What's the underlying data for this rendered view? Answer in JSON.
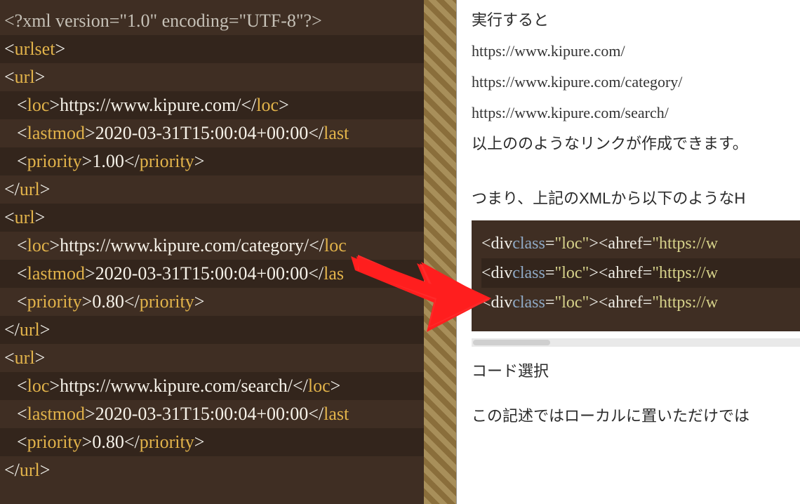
{
  "left_code": {
    "xml_decl": "<?xml version=\"1.0\" encoding=\"UTF-8\"?>",
    "urlset_open": "urlset",
    "url_tag": "url",
    "loc_tag": "loc",
    "lastmod_tag": "lastmod",
    "priority_tag": "priority",
    "entries": [
      {
        "loc": "https://www.kipure.com/",
        "lastmod": "2020-03-31T15:00:04+00:00",
        "priority": "1.00"
      },
      {
        "loc": "https://www.kipure.com/category/",
        "lastmod": "2020-03-31T15:00:04+00:00",
        "priority": "0.80"
      },
      {
        "loc": "https://www.kipure.com/search/",
        "lastmod": "2020-03-31T15:00:04+00:00",
        "priority": "0.80"
      }
    ]
  },
  "right": {
    "para1": "実行すると",
    "urls": [
      "https://www.kipure.com/",
      "https://www.kipure.com/category/",
      "https://www.kipure.com/search/"
    ],
    "para2": "以上ののようなリンクが作成できます。",
    "para3": "つまり、上記のXMLから以下のようなH",
    "html_lines_prefix": "<div ",
    "html_lines_class": "class",
    "html_lines_eq": "=",
    "html_lines_val": "\"loc\"",
    "html_lines_mid": "><a ",
    "html_lines_href": "href",
    "html_lines_hrefval": "\"https://w",
    "para4": "コード選択",
    "para5": "この記述ではローカルに置いただけでは"
  }
}
